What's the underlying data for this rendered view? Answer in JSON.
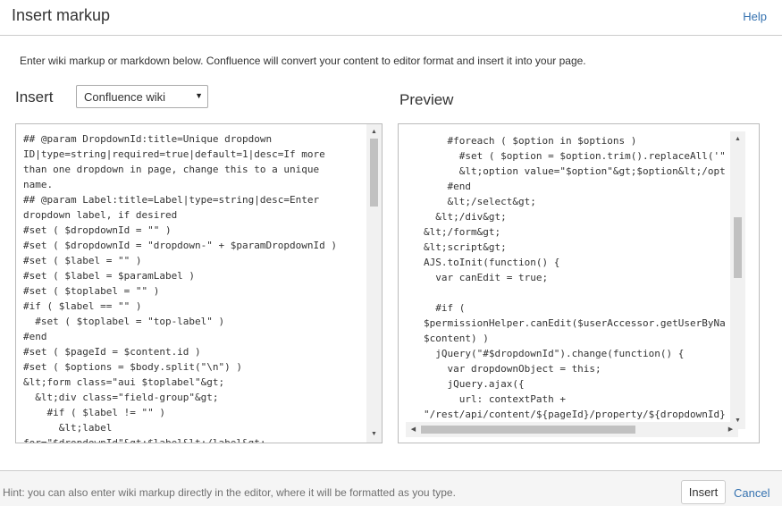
{
  "dialog": {
    "title": "Insert markup",
    "help_label": "Help",
    "intro": "Enter wiki markup or markdown below. Confluence will convert your content to editor format and insert it into your page."
  },
  "insert": {
    "label": "Insert",
    "format_select": {
      "selected": "Confluence wiki"
    },
    "content": "## @param DropdownId:title=Unique dropdown\nID|type=string|required=true|default=1|desc=If more\nthan one dropdown in page, change this to a unique\nname.\n## @param Label:title=Label|type=string|desc=Enter\ndropdown label, if desired\n#set ( $dropdownId = \"\" )\n#set ( $dropdownId = \"dropdown-\" + $paramDropdownId )\n#set ( $label = \"\" )\n#set ( $label = $paramLabel )\n#set ( $toplabel = \"\" )\n#if ( $label == \"\" )\n  #set ( $toplabel = \"top-label\" )\n#end\n#set ( $pageId = $content.id )\n#set ( $options = $body.split(\"\\n\") )\n&lt;form class=\"aui $toplabel\"&gt;\n  &lt;div class=\"field-group\"&gt;\n    #if ( $label != \"\" )\n      &lt;label\nfor=\"$dropdownId\"&gt;$label&lt;/label&gt;"
  },
  "preview": {
    "label": "Preview",
    "content": "    #foreach ( $option in $options )\n      #set ( $option = $option.trim().replaceAll('\"\n      &lt;option value=\"$option\"&gt;$option&lt;/opt\n    #end\n    &lt;/select&gt;\n  &lt;/div&gt;\n&lt;/form&gt;\n&lt;script&gt;\nAJS.toInit(function() {\n  var canEdit = true;\n\n  #if (\n$permissionHelper.canEdit($userAccessor.getUserByNa\n$content) )\n  jQuery(\"#$dropdownId\").change(function() {\n    var dropdownObject = this;\n    jQuery.ajax({\n      url: contextPath +\n\"/rest/api/content/${pageId}/property/${dropdownId}"
  },
  "footer": {
    "hint": "Hint: you can also enter wiki markup directly in the editor, where it will be formatted as you type.",
    "insert_button": "Insert",
    "cancel_label": "Cancel"
  },
  "colors": {
    "link": "#3572b0",
    "border": "#cccccc",
    "footer_bg": "#f5f5f5"
  },
  "icons": [
    "dropdown-arrow-icon",
    "scroll-up-arrow-icon",
    "scroll-down-arrow-icon",
    "scroll-left-arrow-icon",
    "scroll-right-arrow-icon"
  ]
}
